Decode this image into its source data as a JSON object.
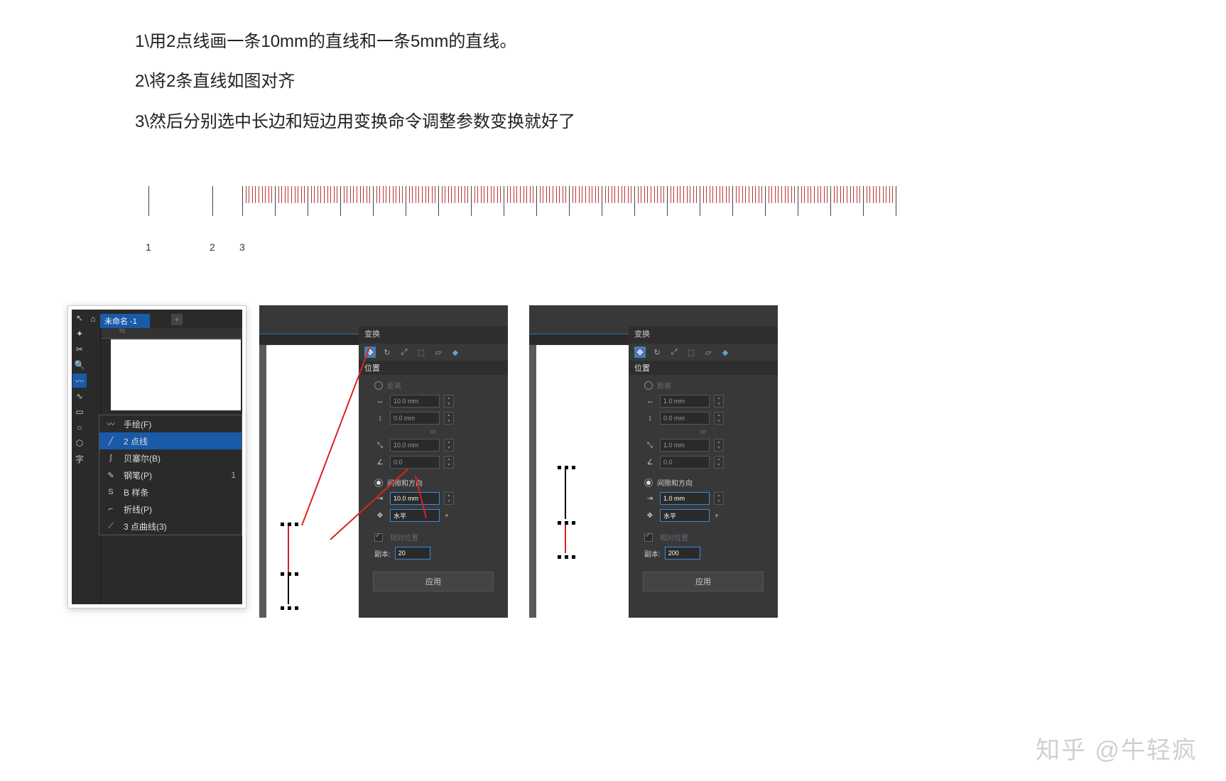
{
  "instructions": {
    "line1": "1\\用2点线画一条10mm的直线和一条5mm的直线。",
    "line2": "2\\将2条直线如图对齐",
    "line3": "3\\然后分别选中长边和短边用变换命令调整参数变换就好了"
  },
  "ruler_labels": {
    "n1": "1",
    "n2": "2",
    "n3": "3"
  },
  "panel1": {
    "tab_title": "未命名 -1",
    "plus": "+",
    "ruler_mark": "70",
    "flyout": {
      "freehand": "手绘(F)",
      "two_point": "2 点线",
      "bezier": "贝塞尔(B)",
      "pen": "钢笔(P)",
      "pen_short": "1",
      "bspline": "B 样条",
      "polyline": "折线(P)",
      "three_point": "3 点曲线(3)"
    }
  },
  "transform_panel": {
    "title": "变换",
    "section_position": "位置",
    "label_distance": "距离",
    "field_h": "10.0 mm",
    "field_v": "0.0 mm",
    "or": "or",
    "field_len": "10.0 mm",
    "field_ang": "0.0",
    "label_gap_dir": "间隙和方向",
    "gap_val_p2": "10.0 mm",
    "gap_val_p3": "1.0 mm",
    "dir_val": "水平",
    "check_relative": "相对位置",
    "copies_label": "副本:",
    "copies_val_p2": "20",
    "copies_val_p3": "200",
    "apply": "应用",
    "p3_field_len": "1.0 mm",
    "p3_field_h": "1.0 mm"
  },
  "watermark": "知乎 @牛轻疯"
}
